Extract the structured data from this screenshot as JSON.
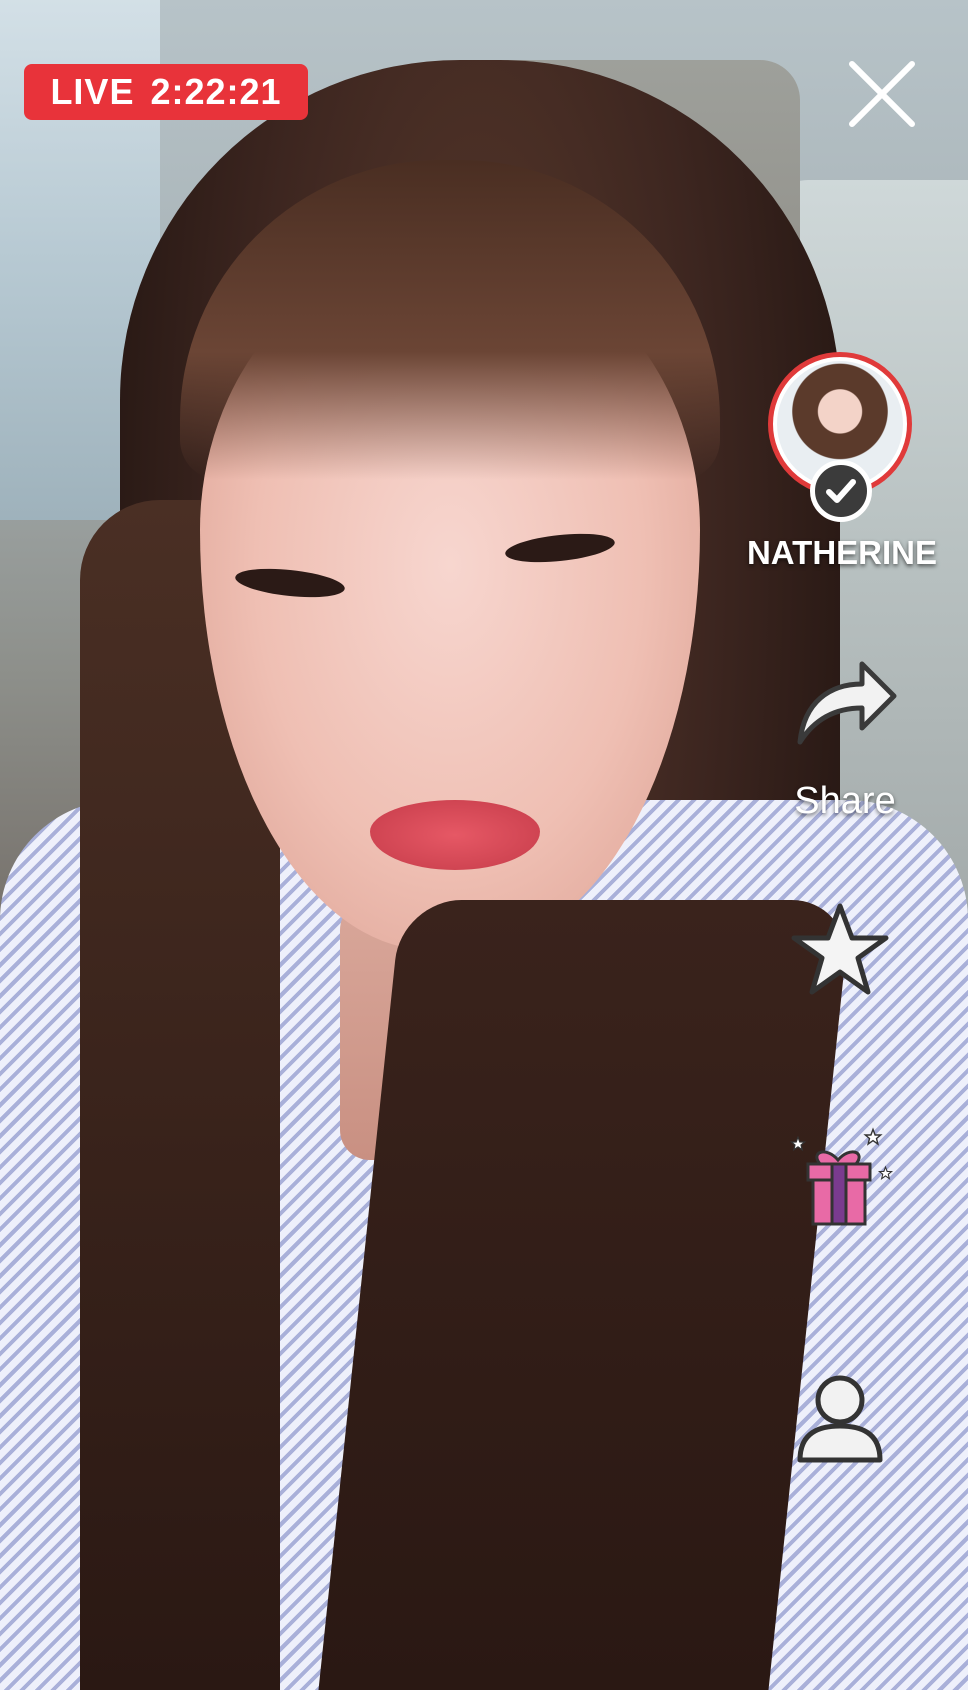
{
  "live": {
    "label": "LIVE",
    "duration": "2:22:21",
    "color": "#e8333a"
  },
  "close": {
    "icon": "close-icon"
  },
  "broadcaster": {
    "name": "NATHERINE",
    "verified": true,
    "avatar_ring_color": "#e03a3a",
    "icon": "verified-check-icon"
  },
  "actions": {
    "share_label": "Share",
    "share_icon": "share-arrow-icon",
    "favorite_icon": "star-icon",
    "gift_icon": "gift-icon",
    "profile_icon": "user-icon"
  }
}
